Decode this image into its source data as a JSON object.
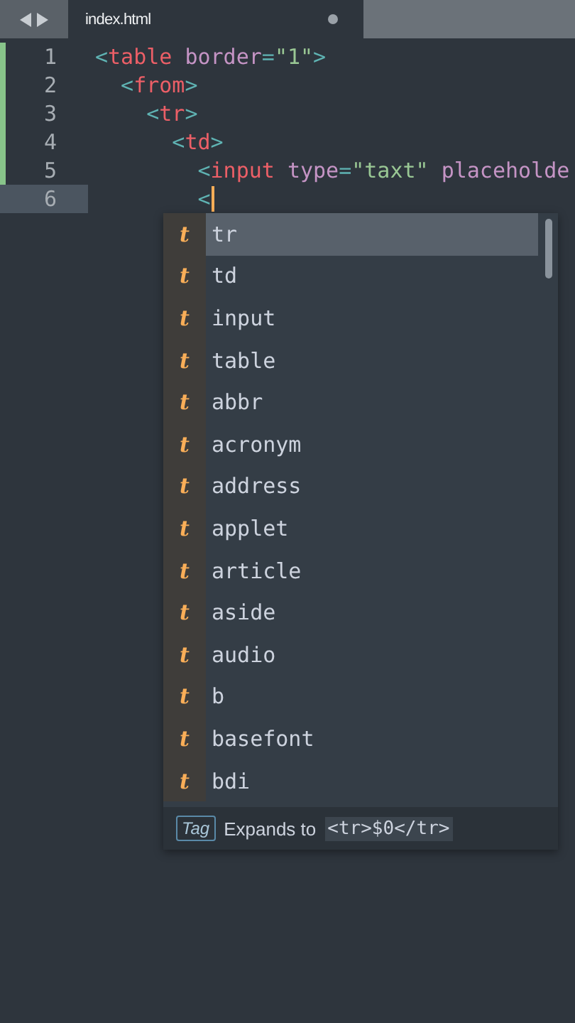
{
  "tab_bar": {
    "tab": {
      "title": "index.html",
      "unsaved": true,
      "selected": true
    }
  },
  "editor": {
    "lines": [
      {
        "number": "1",
        "modified": true,
        "current": false,
        "cursor": false,
        "tokens": [
          {
            "text": "<",
            "kind": "punct"
          },
          {
            "text": "table",
            "kind": "tag"
          },
          {
            "text": " border",
            "kind": "attr"
          },
          {
            "text": "=",
            "kind": "punct"
          },
          {
            "text": "\"1\"",
            "kind": "string"
          },
          {
            "text": ">",
            "kind": "punct"
          }
        ]
      },
      {
        "number": "2",
        "modified": true,
        "current": false,
        "cursor": false,
        "tokens": [
          {
            "text": "  <",
            "kind": "punct"
          },
          {
            "text": "from",
            "kind": "tag"
          },
          {
            "text": ">",
            "kind": "punct"
          }
        ]
      },
      {
        "number": "3",
        "modified": true,
        "current": false,
        "cursor": false,
        "tokens": [
          {
            "text": "    <",
            "kind": "punct"
          },
          {
            "text": "tr",
            "kind": "tag"
          },
          {
            "text": ">",
            "kind": "punct"
          }
        ]
      },
      {
        "number": "4",
        "modified": true,
        "current": false,
        "cursor": false,
        "tokens": [
          {
            "text": "      <",
            "kind": "punct"
          },
          {
            "text": "td",
            "kind": "tag"
          },
          {
            "text": ">",
            "kind": "punct"
          }
        ]
      },
      {
        "number": "5",
        "modified": true,
        "current": false,
        "cursor": false,
        "tokens": [
          {
            "text": "        <",
            "kind": "punct"
          },
          {
            "text": "input",
            "kind": "tag"
          },
          {
            "text": " type",
            "kind": "attr"
          },
          {
            "text": "=",
            "kind": "punct"
          },
          {
            "text": "\"taxt\"",
            "kind": "string"
          },
          {
            "text": " placeholde",
            "kind": "attr"
          }
        ]
      },
      {
        "number": "6",
        "modified": false,
        "current": true,
        "cursor": true,
        "tokens": [
          {
            "text": "        <",
            "kind": "punct"
          }
        ]
      }
    ]
  },
  "autocomplete": {
    "items": [
      {
        "icon": "t",
        "label": "tr",
        "selected": true
      },
      {
        "icon": "t",
        "label": "td",
        "selected": false
      },
      {
        "icon": "t",
        "label": "input",
        "selected": false
      },
      {
        "icon": "t",
        "label": "table",
        "selected": false
      },
      {
        "icon": "t",
        "label": "abbr",
        "selected": false
      },
      {
        "icon": "t",
        "label": "acronym",
        "selected": false
      },
      {
        "icon": "t",
        "label": "address",
        "selected": false
      },
      {
        "icon": "t",
        "label": "applet",
        "selected": false
      },
      {
        "icon": "t",
        "label": "article",
        "selected": false
      },
      {
        "icon": "t",
        "label": "aside",
        "selected": false
      },
      {
        "icon": "t",
        "label": "audio",
        "selected": false
      },
      {
        "icon": "t",
        "label": "b",
        "selected": false
      },
      {
        "icon": "t",
        "label": "basefont",
        "selected": false
      },
      {
        "icon": "t",
        "label": "bdi",
        "selected": false
      }
    ],
    "footer": {
      "kind_badge": "Tag",
      "description": "Expands to",
      "snippet": "<tr>$0</tr>"
    }
  }
}
